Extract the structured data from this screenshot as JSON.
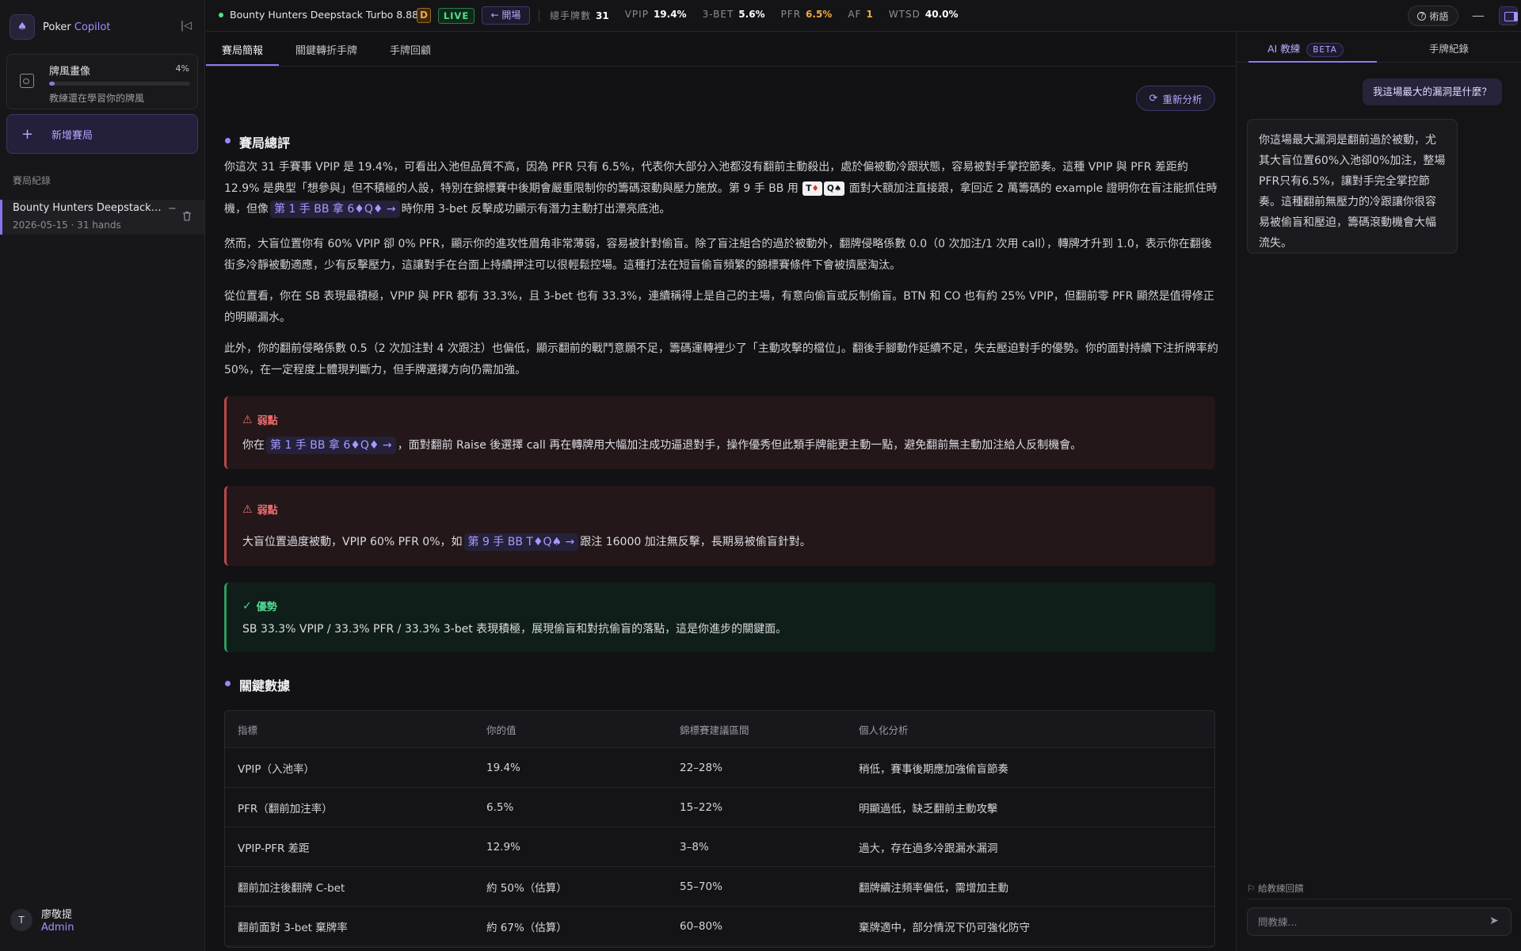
{
  "sidebar": {
    "brand_prefix": "Poker ",
    "brand_accent": "Copilot",
    "profile_title": "牌風畫像",
    "profile_pct": "4%",
    "profile_progress": 0.04,
    "profile_sub": "教練還在學習你的牌風",
    "new_game_label": "新增賽局",
    "section_label": "賽局紀錄",
    "session_title": "Bounty Hunters Deepstack ...",
    "session_meta": "2026-05-15 · 31 hands",
    "user_initial": "T",
    "user_name": "廖敬提",
    "user_role": "Admin"
  },
  "topbar": {
    "title": "Bounty Hunters Deepstack Turbo 8.88",
    "badge_d": "D",
    "badge_live": "LIVE",
    "open_button": "← 開場",
    "term_button": "術語",
    "stats": [
      {
        "k": "總手牌數",
        "v": "31",
        "color": "#ffffff"
      },
      {
        "k": "VPIP",
        "v": "19.4%",
        "color": "#ffffff"
      },
      {
        "k": "3-BET",
        "v": "5.6%",
        "color": "#ffffff"
      },
      {
        "k": "PFR",
        "v": "6.5%",
        "color": "#f3a842"
      },
      {
        "k": "AF",
        "v": "1",
        "color": "#f3a842"
      },
      {
        "k": "WTSD",
        "v": "40.0%",
        "color": "#ffffff"
      }
    ]
  },
  "main": {
    "tabs": [
      "賽局簡報",
      "關鍵轉折手牌",
      "手牌回顧"
    ],
    "reanalyze": "重新分析",
    "summary_title": "賽局總評",
    "p1": {
      "a": "你這次 31 手賽事 VPIP 是 19.4%，可看出入池但品質不高，因為 PFR 只有 6.5%，代表你大部分入池都沒有翻前主動殺出，處於偏被動冷跟狀態，容易被對手掌控節奏。這種 VPIP 與 PFR 差距約 12.9% 是典型「想參與」但不積極的人設，特別在錦標賽中後期會嚴重限制你的籌碼滾動與壓力施放。第 9 手 BB 用",
      "card1_rank": "T",
      "card1_suit": "♦",
      "card2_rank": "Q",
      "card2_suit": "♠",
      "b": "面對大額加注直接跟，拿回近 2 萬籌碼的 example 證明你在盲注能抓住時機，但像",
      "link": "第 1 手 BB 拿 6♦Q♦ →",
      "c": "時你用 3-bet 反擊成功顯示有潛力主動打出漂亮底池。"
    },
    "p2": "然而，大盲位置你有 60% VPIP 卻 0% PFR，顯示你的進攻性眉角非常薄弱，容易被針對偷盲。除了盲注組合的過於被動外，翻牌侵略係數 0.0（0 次加注/1 次用 call），轉牌才升到 1.0，表示你在翻後街多冷靜被動適應，少有反擊壓力，這讓對手在台面上持續押注可以很輕鬆控場。這種打法在短盲偷盲頻繁的錦標賽條件下會被擠壓淘汰。",
    "p3": "從位置看，你在 SB 表現最積極，VPIP 與 PFR 都有 33.3%，且 3-bet 也有 33.3%，連續稱得上是自己的主場，有意向偷盲或反制偷盲。BTN 和 CO 也有約 25% VPIP，但翻前零 PFR 顯然是值得修正的明顯漏水。",
    "p4": "此外，你的翻前侵略係數 0.5（2 次加注對 4 次跟注）也偏低，顯示翻前的戰鬥意願不足，籌碼運轉裡少了「主動攻擊的檔位」。翻後手腳動作延續不足，失去壓迫對手的優勢。你的面對持續下注折牌率約 50%，在一定程度上體現判斷力，但手牌選擇方向仍需加強。",
    "weak1": {
      "head": "弱點",
      "a": "你在",
      "link": "第 1 手 BB 拿 6♦Q♦ →",
      "b": "，面對翻前 Raise 後選擇 call 再在轉牌用大幅加注成功逼退對手，操作優秀但此類手牌能更主動一點，避免翻前無主動加注給人反制機會。"
    },
    "weak2": {
      "head": "弱點",
      "a": "大盲位置過度被動，VPIP 60% PFR 0%，如",
      "link": "第 9 手 BB T♦Q♠ →",
      "b": "跟注 16000 加注無反擊，長期易被偷盲針對。"
    },
    "strong": {
      "head": "優勢",
      "body": "SB 33.3% VPIP / 33.3% PFR / 33.3% 3-bet 表現積極，展現偷盲和對抗偷盲的落點，這是你進步的關鍵面。"
    },
    "data_title": "關鍵數據",
    "table": {
      "headers": [
        "指標",
        "你的值",
        "錦標賽建議區間",
        "個人化分析"
      ],
      "rows": [
        [
          "VPIP（入池率）",
          "19.4%",
          "22–28%",
          "稍低，賽事後期應加強偷盲節奏"
        ],
        [
          "PFR（翻前加注率）",
          "6.5%",
          "15–22%",
          "明顯過低，缺乏翻前主動攻擊"
        ],
        [
          "VPIP-PFR 差距",
          "12.9%",
          "3–8%",
          "過大，存在過多冷跟漏水漏洞"
        ],
        [
          "翻前加注後翻牌 C-bet",
          "約 50%（估算）",
          "55–70%",
          "翻牌續注頻率偏低，需增加主動"
        ],
        [
          "翻前面對 3-bet 棄牌率",
          "約 67%（估算）",
          "60–80%",
          "棄牌適中，部分情況下仍可強化防守"
        ]
      ]
    }
  },
  "right": {
    "tab_ai": "AI 教練",
    "beta": "BETA",
    "tab_history": "手牌紀錄",
    "user_msg": "我這場最大的漏洞是什麼？",
    "ai_msg": "你這場最大漏洞是翻前過於被動，尤其大盲位置60%入池卻0%加注，整場PFR只有6.5%，讓對手完全掌控節奏。這種翻前無壓力的冷跟讓你很容易被偷盲和壓迫，籌碼滾動機會大幅流失。",
    "feedback": "給教練回饋",
    "input_placeholder": "問教練..."
  }
}
